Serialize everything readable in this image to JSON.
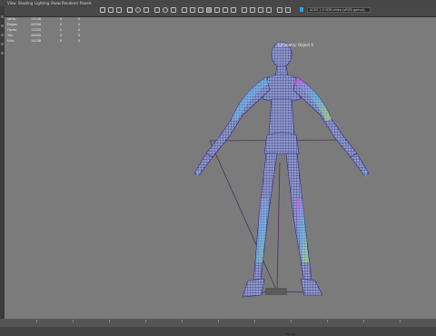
{
  "menubar": {
    "items": [
      "View",
      "Shading",
      "Lighting",
      "Show",
      "Renderer",
      "Panels"
    ]
  },
  "toolbar": {
    "render_field_value": "ACES 1.0 SDR-video (sRGB gamut)"
  },
  "hud": {
    "rows": [
      {
        "label": "Verts:",
        "v1": "13158",
        "v2": "0",
        "v3": "0"
      },
      {
        "label": "Edges:",
        "v1": "26356",
        "v2": "0",
        "v3": "0"
      },
      {
        "label": "Faces:",
        "v1": "13200",
        "v2": "0",
        "v3": "0"
      },
      {
        "label": "Tris:",
        "v1": "26400",
        "v2": "0",
        "v3": "0"
      },
      {
        "label": "UVs:",
        "v1": "14158",
        "v2": "0",
        "v3": "0"
      }
    ]
  },
  "viewport": {
    "symmetry_label": "Symmetry: Object X",
    "camera_label": "persp"
  },
  "colors": {
    "viewport_bg": "#7b7b7b",
    "wire": "#3d3a8c",
    "selection_blue": "#27a3e0"
  },
  "icons": [
    "select-tool-icon",
    "lasso-icon",
    "paint-icon",
    "move-icon",
    "rotate-icon",
    "scale-icon",
    "snap-grid-icon",
    "snap-curve-icon",
    "snap-point-icon",
    "camera-icon"
  ]
}
